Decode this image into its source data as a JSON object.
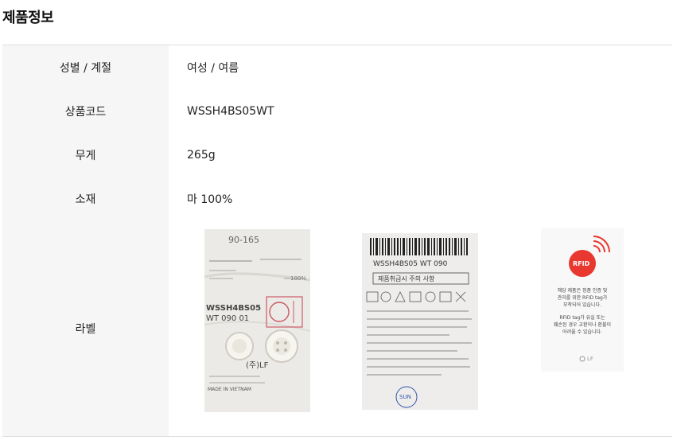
{
  "section": {
    "title": "제품정보"
  },
  "specs": [
    {
      "key": "성별 / 계절",
      "value": "여성 / 여름"
    },
    {
      "key": "상품코드",
      "value": "WSSH4BS05WT"
    },
    {
      "key": "무게",
      "value": "265g"
    },
    {
      "key": "소재",
      "value": "마 100%"
    }
  ],
  "label": {
    "key": "라벨",
    "care_label": {
      "size": "90-165",
      "code": "WSSH4BS05",
      "color_size": "WT 090 01",
      "origin": "MADE IN VIETNAM",
      "company": "(주)LF",
      "material": "100%"
    },
    "barcode_label": {
      "code": "WSSH4BS05 WT 090",
      "care_title": "제품취급시 주의 사항",
      "brand": "SUN"
    },
    "rfid_card": {
      "badge": "RFID",
      "line1": "해당 제품은 정품 인증 및",
      "line2": "관리를 위한 RFID tag가",
      "line3": "부착되어 있습니다.",
      "line4": "RFID tag가 유실 또는",
      "line5": "훼손된 경우 교환이나 환불이",
      "line6": "어려울 수 있습니다.",
      "logo": "LF"
    }
  }
}
